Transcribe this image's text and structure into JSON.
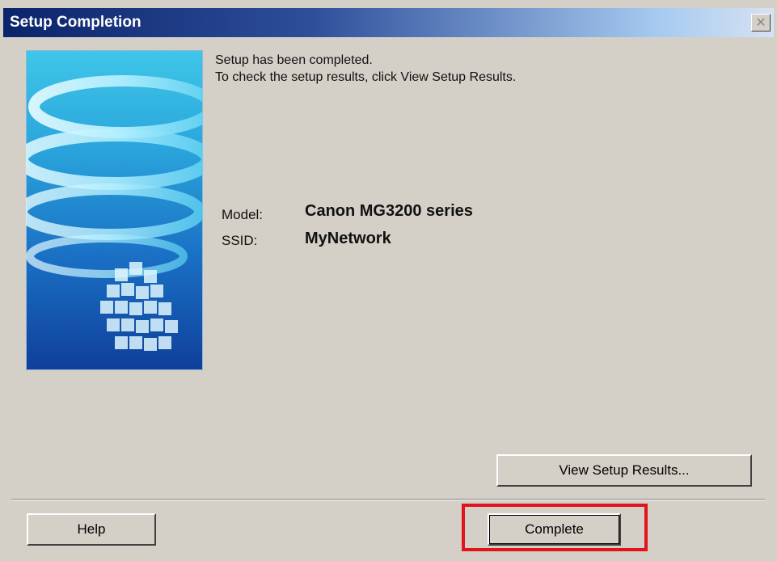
{
  "window": {
    "title": "Setup Completion",
    "close_glyph": "✕"
  },
  "message": {
    "line1": "Setup has been completed.",
    "line2": "To check the setup results, click View Setup Results."
  },
  "details": {
    "model_label": "Model:",
    "model_value": "Canon MG3200 series",
    "ssid_label": "SSID:",
    "ssid_value": "MyNetwork"
  },
  "buttons": {
    "view_results": "View Setup Results...",
    "help": "Help",
    "complete": "Complete"
  },
  "colors": {
    "title_gradient_start": "#0a246a",
    "title_gradient_end": "#d6e2f2",
    "dialog_bg": "#d4d0c8",
    "highlight": "#e0141a"
  },
  "icons": {
    "close": "close-icon",
    "banner": "spiral-cubes-banner-image"
  }
}
